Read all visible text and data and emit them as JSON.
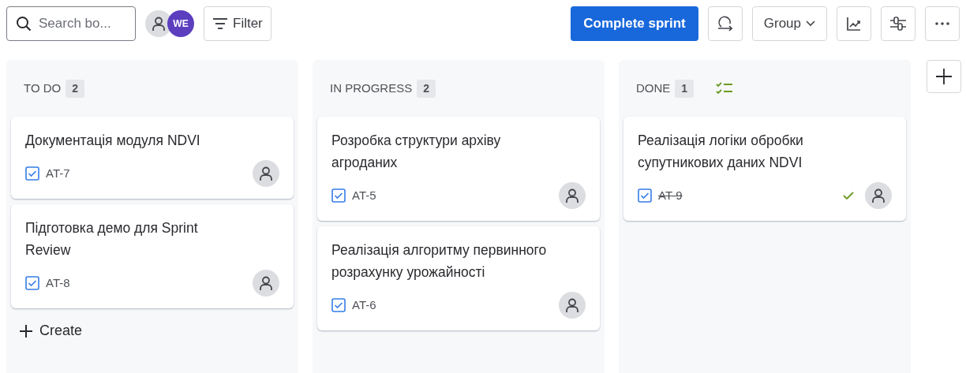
{
  "toolbar": {
    "search": {
      "placeholder": "Search bo..."
    },
    "avatars": [
      {
        "kind": "user"
      },
      {
        "kind": "initials",
        "initials": "WE",
        "color": "#5b3fbf"
      }
    ],
    "filter": "Filter",
    "complete_button": "Complete sprint",
    "group": "Group"
  },
  "columns": [
    {
      "title": "TO DO",
      "count": "2",
      "complete": false,
      "create": "Create",
      "cards": [
        {
          "title": "Документація модуля NDVI",
          "key": "AT-7",
          "done": false
        },
        {
          "title": "Підготовка демо для Sprint Review",
          "key": "AT-8",
          "done": false
        }
      ]
    },
    {
      "title": "IN PROGRESS",
      "count": "2",
      "complete": false,
      "cards": [
        {
          "title": "Розробка структури архіву агроданих",
          "key": "AT-5",
          "done": false
        },
        {
          "title": "Реалізація алгоритму первинного розрахунку урожайності",
          "key": "AT-6",
          "done": false
        }
      ]
    },
    {
      "title": "DONE",
      "count": "1",
      "complete": true,
      "cards": [
        {
          "title": "Реалізація логіки обробки супутникових даних NDVI",
          "key": "AT-9",
          "done": true
        }
      ]
    }
  ]
}
